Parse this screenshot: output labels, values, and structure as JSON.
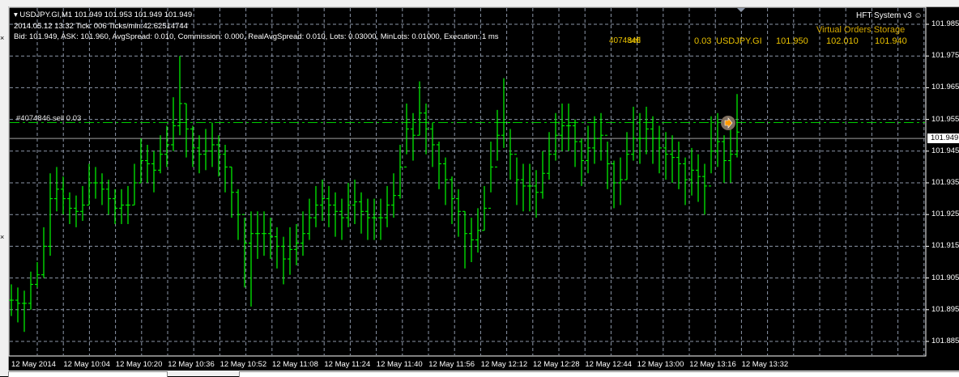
{
  "header": {
    "symbol_line": "USDJPY.GI,M1  101.949 101.953 101.949 101.949",
    "tick_line": "2014.05.12 13:32 Tick: 006 Ticks/min:42.62514744",
    "info_line": "Bid: 101.949, ASK: 101.960, AvgSpread: 0.010, Commission: 0.000, RealAvgSpread: 0.010, Lots: 0.03000, MinLots: 0.01000, Execution: 1 ms"
  },
  "ea": {
    "name": "HFT System v3",
    "icon": "smiley-icon"
  },
  "virtual_orders": {
    "title": "Virtual Orders Storage",
    "row": {
      "ticket": "4074846",
      "type": "sell",
      "lots": "0.03",
      "symbol": "USDJPY.GI",
      "open": "101.950",
      "tp": "102.010",
      "sl": "101.940"
    }
  },
  "order_line": {
    "label": "#4074846 sell 0.03",
    "price": 101.954
  },
  "current_price": {
    "label": "101.949",
    "value": 101.949
  },
  "colors": {
    "bars": "#00ff00",
    "grid": "#8c96a8",
    "orders": "#e8c000",
    "order_line": "#00cc00"
  },
  "chart_data": {
    "type": "ohlc",
    "ylim": [
      101.88,
      101.99
    ],
    "price_ticks": [
      "101.985",
      "101.975",
      "101.965",
      "101.955",
      "101.945",
      "101.935",
      "101.925",
      "101.915",
      "101.905",
      "101.895",
      "101.885"
    ],
    "time_labels": [
      "12 May 2014",
      "12 May 10:04",
      "12 May 10:20",
      "12 May 10:36",
      "12 May 10:52",
      "12 May 11:08",
      "12 May 11:24",
      "12 May 11:40",
      "12 May 11:56",
      "12 May 12:12",
      "12 May 12:28",
      "12 May 12:44",
      "12 May 13:00",
      "12 May 13:16",
      "12 May 13:32"
    ],
    "bars_hlc": [
      [
        101.903,
        101.893,
        101.898
      ],
      [
        101.902,
        101.891,
        101.897
      ],
      [
        101.901,
        101.888,
        101.897
      ],
      [
        101.907,
        101.895,
        101.903
      ],
      [
        101.91,
        101.902,
        101.906
      ],
      [
        101.921,
        101.905,
        101.915
      ],
      [
        101.938,
        101.912,
        101.93
      ],
      [
        101.94,
        101.926,
        101.933
      ],
      [
        101.937,
        101.925,
        101.93
      ],
      [
        101.932,
        101.922,
        101.927
      ],
      [
        101.931,
        101.921,
        101.926
      ],
      [
        101.934,
        101.923,
        101.928
      ],
      [
        101.941,
        101.928,
        101.935
      ],
      [
        101.94,
        101.93,
        101.935
      ],
      [
        101.938,
        101.928,
        101.933
      ],
      [
        101.936,
        101.925,
        101.93
      ],
      [
        101.933,
        101.922,
        101.927
      ],
      [
        101.933,
        101.922,
        101.928
      ],
      [
        101.934,
        101.922,
        101.928
      ],
      [
        101.941,
        101.928,
        101.935
      ],
      [
        101.949,
        101.935,
        101.942
      ],
      [
        101.947,
        101.935,
        101.941
      ],
      [
        101.945,
        101.932,
        101.939
      ],
      [
        101.95,
        101.938,
        101.944
      ],
      [
        101.953,
        101.94,
        101.947
      ],
      [
        101.962,
        101.945,
        101.953
      ],
      [
        101.975,
        101.95,
        101.96
      ],
      [
        101.96,
        101.943,
        101.952
      ],
      [
        101.953,
        101.94,
        101.946
      ],
      [
        101.95,
        101.938,
        101.944
      ],
      [
        101.952,
        101.939,
        101.945
      ],
      [
        101.954,
        101.94,
        101.947
      ],
      [
        101.95,
        101.937,
        101.944
      ],
      [
        101.947,
        101.932,
        101.94
      ],
      [
        101.94,
        101.924,
        101.932
      ],
      [
        101.933,
        101.917,
        101.925
      ],
      [
        101.924,
        101.902,
        101.916
      ],
      [
        101.926,
        101.896,
        101.919
      ],
      [
        101.926,
        101.911,
        101.919
      ],
      [
        101.926,
        101.912,
        101.919
      ],
      [
        101.924,
        101.911,
        101.918
      ],
      [
        101.921,
        101.908,
        101.915
      ],
      [
        101.918,
        101.903,
        101.911
      ],
      [
        101.921,
        101.906,
        101.914
      ],
      [
        101.922,
        101.909,
        101.916
      ],
      [
        101.926,
        101.912,
        101.919
      ],
      [
        101.93,
        101.917,
        101.924
      ],
      [
        101.934,
        101.921,
        101.928
      ],
      [
        101.936,
        101.923,
        101.93
      ],
      [
        101.934,
        101.921,
        101.928
      ],
      [
        101.932,
        101.918,
        101.926
      ],
      [
        101.93,
        101.917,
        101.924
      ],
      [
        101.935,
        101.921,
        101.928
      ],
      [
        101.936,
        101.922,
        101.929
      ],
      [
        101.932,
        101.919,
        101.926
      ],
      [
        101.93,
        101.917,
        101.924
      ],
      [
        101.93,
        101.917,
        101.924
      ],
      [
        101.93,
        101.917,
        101.924
      ],
      [
        101.934,
        101.921,
        101.928
      ],
      [
        101.938,
        101.924,
        101.931
      ],
      [
        101.947,
        101.93,
        101.94
      ],
      [
        101.96,
        101.944,
        101.952
      ],
      [
        101.957,
        101.942,
        101.95
      ],
      [
        101.967,
        101.95,
        101.957
      ],
      [
        101.96,
        101.944,
        101.952
      ],
      [
        101.954,
        101.94,
        101.947
      ],
      [
        101.948,
        101.933,
        101.941
      ],
      [
        101.943,
        101.928,
        101.936
      ],
      [
        101.937,
        101.922,
        101.93
      ],
      [
        101.933,
        101.918,
        101.926
      ],
      [
        101.926,
        101.908,
        101.919
      ],
      [
        101.924,
        101.91,
        101.917
      ],
      [
        101.927,
        101.913,
        101.92
      ],
      [
        101.934,
        101.92,
        101.927
      ],
      [
        101.948,
        101.932,
        101.94
      ],
      [
        101.958,
        101.942,
        101.95
      ],
      [
        101.968,
        101.946,
        101.954
      ],
      [
        101.952,
        101.936,
        101.944
      ],
      [
        101.943,
        101.928,
        101.936
      ],
      [
        101.941,
        101.926,
        101.934
      ],
      [
        101.941,
        101.926,
        101.934
      ],
      [
        101.939,
        101.924,
        101.932
      ],
      [
        101.945,
        101.93,
        101.938
      ],
      [
        101.951,
        101.936,
        101.944
      ],
      [
        101.957,
        101.942,
        101.95
      ],
      [
        101.96,
        101.945,
        101.953
      ],
      [
        101.96,
        101.945,
        101.953
      ],
      [
        101.955,
        101.94,
        101.948
      ],
      [
        101.949,
        101.934,
        101.942
      ],
      [
        101.953,
        101.938,
        101.946
      ],
      [
        101.956,
        101.941,
        101.949
      ],
      [
        101.957,
        101.942,
        101.95
      ],
      [
        101.948,
        101.933,
        101.941
      ],
      [
        101.942,
        101.927,
        101.935
      ],
      [
        101.943,
        101.928,
        101.936
      ],
      [
        101.951,
        101.936,
        101.944
      ],
      [
        101.959,
        101.942,
        101.949
      ],
      [
        101.957,
        101.941,
        101.949
      ],
      [
        101.959,
        101.944,
        101.952
      ],
      [
        101.956,
        101.941,
        101.949
      ],
      [
        101.953,
        101.938,
        101.946
      ],
      [
        101.951,
        101.936,
        101.944
      ],
      [
        101.95,
        101.935,
        101.943
      ],
      [
        101.948,
        101.933,
        101.941
      ],
      [
        101.943,
        101.928,
        101.936
      ],
      [
        101.946,
        101.931,
        101.939
      ],
      [
        101.944,
        101.929,
        101.937
      ],
      [
        101.941,
        101.925,
        101.934
      ],
      [
        101.956,
        101.938,
        101.945
      ],
      [
        101.957,
        101.94,
        101.948
      ],
      [
        101.95,
        101.935,
        101.942
      ],
      [
        101.952,
        101.935,
        101.944
      ],
      [
        101.963,
        101.943,
        101.951
      ]
    ]
  }
}
